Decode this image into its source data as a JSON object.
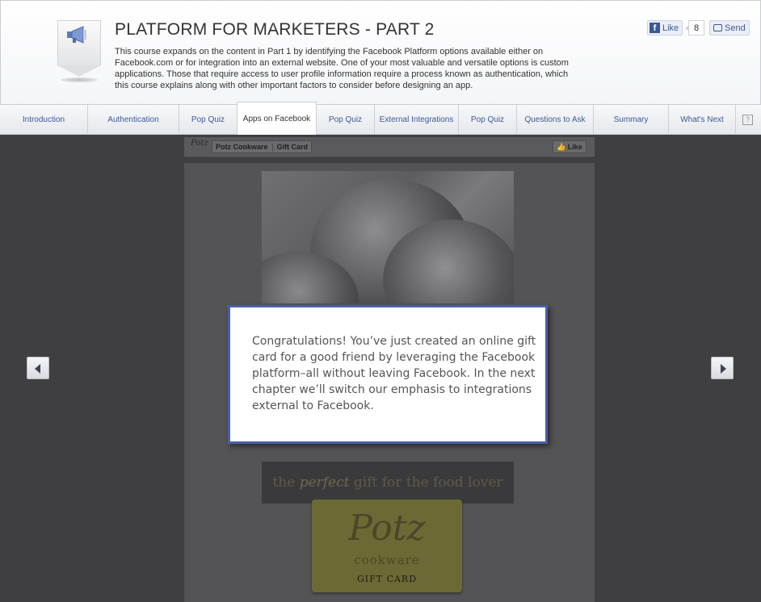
{
  "header": {
    "title": "PLATFORM FOR MARKETERS - PART 2",
    "description": "This course expands on the content in Part 1 by identifying the Facebook Platform options available either on Facebook.com or for integration into an external website. One of your most valuable and versatile options is custom applications. Those that require access to user profile information require a process known as authentication, which this course explains along with other important factors to consider before designing an app.",
    "badge_icon": "megaphone-icon"
  },
  "social": {
    "like_label": "Like",
    "like_count": "8",
    "send_label": "Send"
  },
  "tabs": [
    {
      "label": "Introduction"
    },
    {
      "label": "Authentication"
    },
    {
      "label": "Pop Quiz"
    },
    {
      "label": "Apps on Facebook"
    },
    {
      "label": "Pop Quiz"
    },
    {
      "label": "External Integrations"
    },
    {
      "label": "Pop Quiz"
    },
    {
      "label": "Questions to Ask"
    },
    {
      "label": "Summary"
    },
    {
      "label": "What's Next"
    }
  ],
  "active_tab": "Apps on Facebook",
  "help_label": "?",
  "app_preview": {
    "breadcrumb_page": "Potz Cookware",
    "breadcrumb_app": "Gift Card",
    "mini_like": "Like",
    "banner_pre": "the",
    "banner_em": "perfect",
    "banner_post": "gift for the food lover",
    "card_logo": "Potz",
    "card_sub": "cookware",
    "card_label": "GIFT CARD"
  },
  "modal": {
    "text": "Congratulations! You’ve just created an online gift card for a good friend by leveraging the Facebook platform–all without leaving Facebook. In the next chapter we’ll switch our emphasis to integrations external to Facebook."
  },
  "colors": {
    "accent": "#3b5998",
    "modal_border": "#4a5fa8",
    "overlay": "#3f3f41"
  }
}
